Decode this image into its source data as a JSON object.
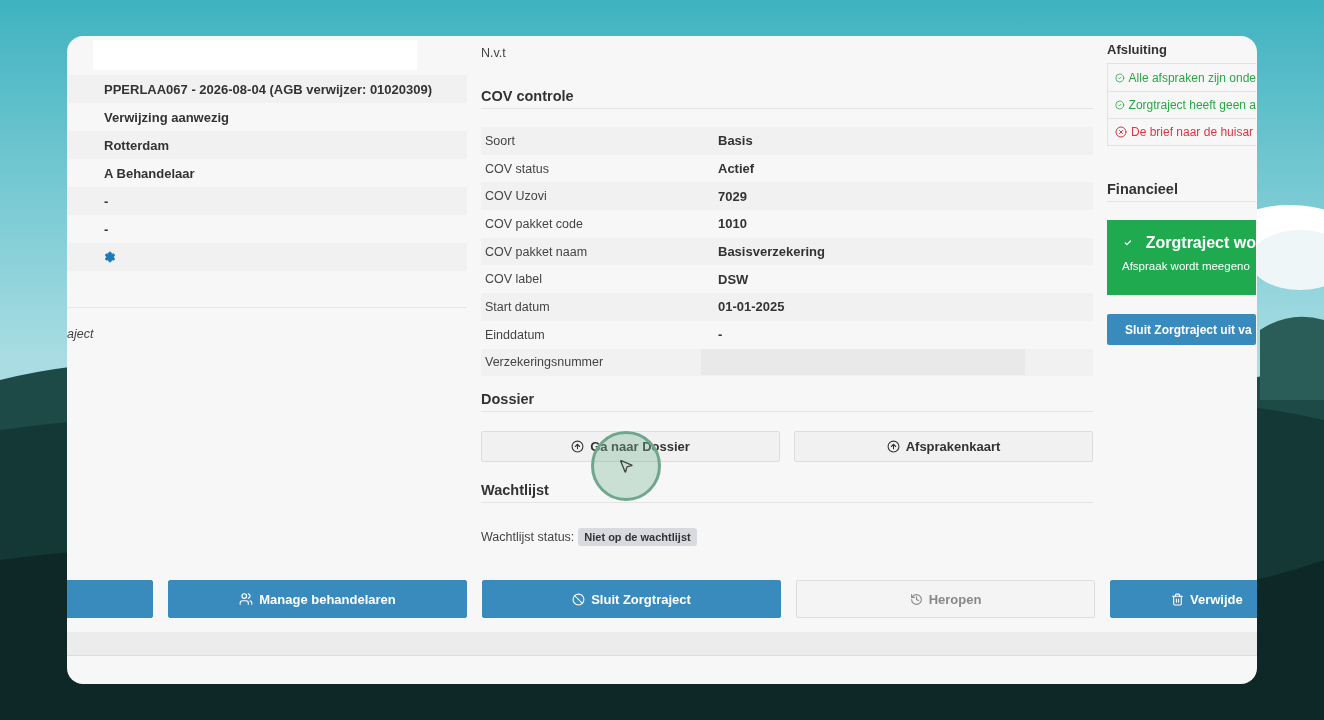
{
  "left_panel": {
    "rows": [
      {
        "kind": "text",
        "value": "PPERLAA067 - 2026-08-04 (AGB verwijzer: 01020309)"
      },
      {
        "kind": "text",
        "value": "Verwijzing aanwezig"
      },
      {
        "kind": "text",
        "value": "Rotterdam"
      },
      {
        "kind": "text",
        "value": "A Behandelaar"
      },
      {
        "kind": "text",
        "value": "-"
      },
      {
        "kind": "text",
        "value": "-"
      },
      {
        "kind": "settings"
      }
    ],
    "note": "aject"
  },
  "top_text": "N.v.t",
  "cov": {
    "title": "COV controle",
    "rows": [
      {
        "label": "Soort",
        "value": "Basis"
      },
      {
        "label": "COV status",
        "value": "Actief"
      },
      {
        "label": "COV Uzovi",
        "value": "7029"
      },
      {
        "label": "COV pakket code",
        "value": "1010"
      },
      {
        "label": "COV pakket naam",
        "value": "Basisverzekering"
      },
      {
        "label": "COV label",
        "value": "DSW"
      },
      {
        "label": "Start datum",
        "value": "01-01-2025"
      },
      {
        "label": "Einddatum",
        "value": "-"
      },
      {
        "label": "Verzekeringsnummer",
        "redacted": true
      }
    ]
  },
  "dossier": {
    "title": "Dossier",
    "buttons": [
      "Ga naar Dossier",
      "Afsprakenkaart"
    ]
  },
  "wachtlijst": {
    "title": "Wachtlijst",
    "label": "Wachtlijst status:",
    "badge": "Niet op de wachtlijst"
  },
  "afsluiting": {
    "title": "Afsluiting",
    "checks": [
      {
        "text": "Alle afspraken zijn onde",
        "passed": true
      },
      {
        "text": "Zorgtraject heeft geen a",
        "passed": true
      },
      {
        "text": "De brief naar de huisar",
        "passed": false
      }
    ]
  },
  "financieel": {
    "title": "Financieel",
    "alert": {
      "title": "Zorgtraject wo",
      "text": "Afspraak wordt meegeno"
    },
    "button": "Sluit Zorgtraject uit va"
  },
  "actions": [
    {
      "kind": "blank",
      "disabled": false
    },
    {
      "kind": "manage",
      "label": "Manage behandelaren",
      "disabled": false
    },
    {
      "kind": "close",
      "label": "Sluit Zorgtraject",
      "disabled": false
    },
    {
      "kind": "reopen",
      "label": "Heropen",
      "disabled": true
    },
    {
      "kind": "delete",
      "label": "Verwijde",
      "disabled": false
    }
  ]
}
